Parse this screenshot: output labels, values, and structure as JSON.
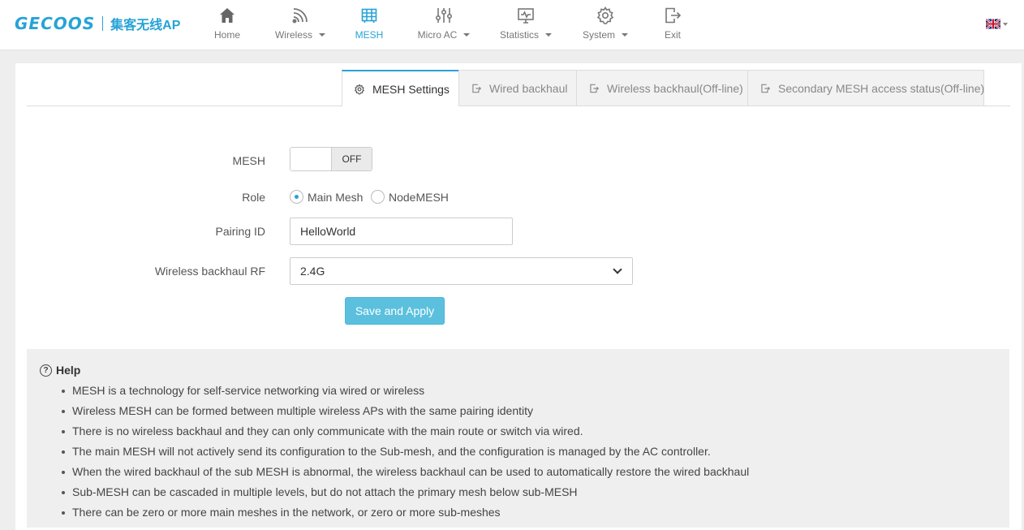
{
  "brand": {
    "logo": "GECOOS",
    "subtitle": "集客无线AP"
  },
  "nav": [
    {
      "id": "home",
      "label": "Home",
      "icon": "home-icon",
      "dropdown": false,
      "active": false
    },
    {
      "id": "wireless",
      "label": "Wireless",
      "icon": "wifi-icon",
      "dropdown": true,
      "active": false
    },
    {
      "id": "mesh",
      "label": "MESH",
      "icon": "mesh-icon",
      "dropdown": false,
      "active": true
    },
    {
      "id": "micro-ac",
      "label": "Micro AC",
      "icon": "sliders-icon",
      "dropdown": true,
      "active": false
    },
    {
      "id": "statistics",
      "label": "Statistics",
      "icon": "monitor-icon",
      "dropdown": true,
      "active": false
    },
    {
      "id": "system",
      "label": "System",
      "icon": "gear-icon",
      "dropdown": true,
      "active": false
    },
    {
      "id": "exit",
      "label": "Exit",
      "icon": "exit-icon",
      "dropdown": false,
      "active": false
    }
  ],
  "colors": {
    "accent": "#27a3d6",
    "button": "#5bc0de",
    "help_bg": "#efefef"
  },
  "tabs": [
    {
      "label": "MESH Settings",
      "icon": "gear-icon",
      "active": true
    },
    {
      "label": "Wired backhaul",
      "icon": "export-icon",
      "active": false
    },
    {
      "label": "Wireless backhaul(Off-line)",
      "icon": "export-icon",
      "active": false
    },
    {
      "label": "Secondary MESH access status(Off-line)",
      "icon": "export-icon",
      "active": false
    }
  ],
  "form": {
    "mesh_label": "MESH",
    "mesh_state": "OFF",
    "role_label": "Role",
    "role_options": [
      "Main Mesh",
      "NodeMESH"
    ],
    "role_selected": "Main Mesh",
    "pairing_label": "Pairing ID",
    "pairing_value": "HelloWorld",
    "rf_label": "Wireless backhaul RF",
    "rf_value": "2.4G",
    "save_label": "Save and Apply"
  },
  "help": {
    "title": "Help",
    "items": [
      "MESH is a technology for self-service networking via wired or wireless",
      "Wireless MESH can be formed between multiple wireless APs with the same pairing identity",
      "There is no wireless backhaul and they can only communicate with the main route or switch via wired.",
      "The main MESH will not actively send its configuration to the Sub-mesh, and the configuration is managed by the AC controller.",
      "When the wired backhaul of the sub MESH is abnormal, the wireless backhaul can be used to automatically restore the wired backhaul",
      "Sub-MESH can be cascaded in multiple levels, but do not attach the primary mesh below sub-MESH",
      "There can be zero or more main meshes in the network, or zero or more sub-meshes"
    ]
  }
}
